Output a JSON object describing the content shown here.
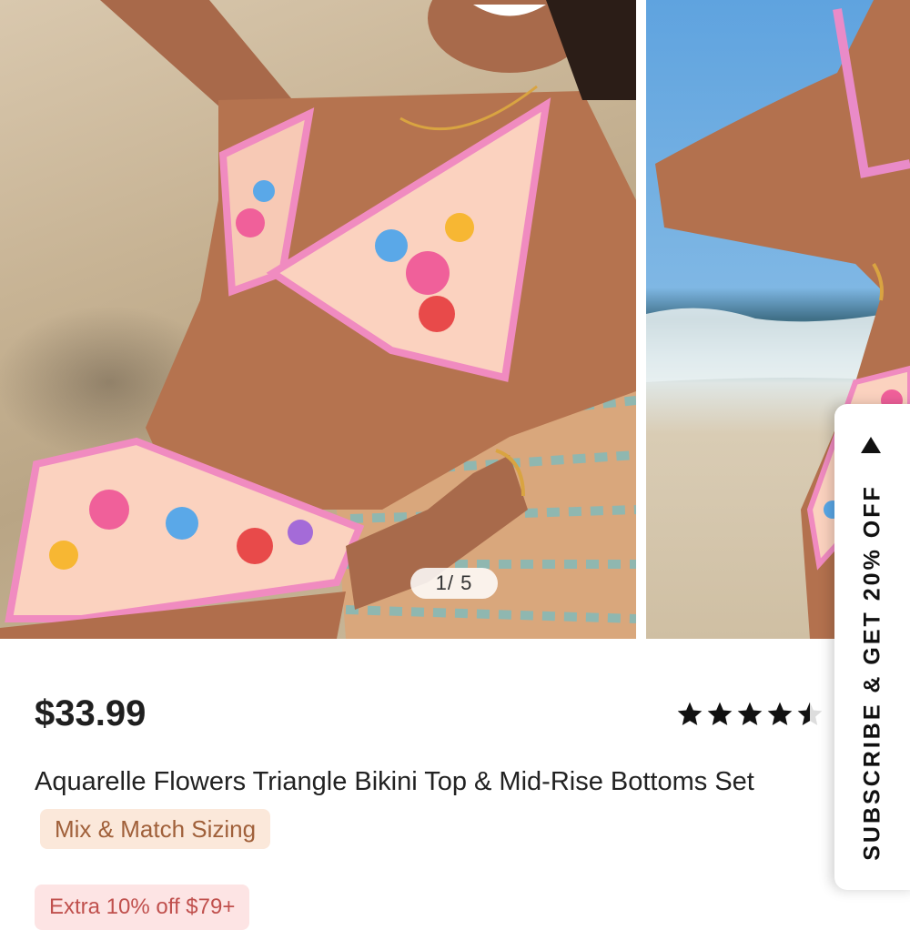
{
  "gallery": {
    "page_indicator": "1/ 5",
    "current_page": 1,
    "total_pages": 5
  },
  "product": {
    "price": "$33.99",
    "rating_value": 4.5,
    "rating_max": 5,
    "title": "Aquarelle Flowers Triangle Bikini Top & Mid-Rise Bottoms Set",
    "sizing_chip": "Mix & Match Sizing",
    "promo_badge": "Extra 10% off $79+"
  },
  "subscribe_tab": {
    "label": "SUBSCRIBE & GET 20% OFF",
    "arrow_icon": "triangle-up-icon"
  },
  "colors": {
    "price": "#1f1f1f",
    "chip_bg": "#fbe8da",
    "chip_text": "#a0603a",
    "promo_bg": "#fde4e4",
    "promo_text": "#c0504d",
    "star": "#111111"
  }
}
